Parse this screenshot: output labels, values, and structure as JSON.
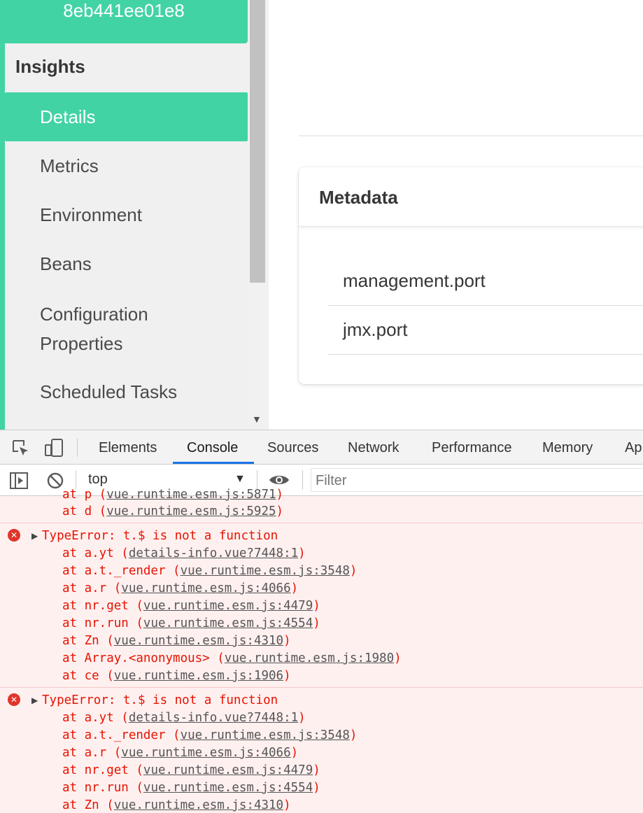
{
  "sidebar": {
    "app_id": "8eb441ee01e8",
    "section_label": "Insights",
    "items": [
      {
        "label": "Details",
        "active": true
      },
      {
        "label": "Metrics"
      },
      {
        "label": "Environment"
      },
      {
        "label": "Beans"
      },
      {
        "label": "Configuration Properties"
      },
      {
        "label": "Scheduled Tasks"
      }
    ]
  },
  "metadata": {
    "title": "Metadata",
    "keys": [
      "management.port",
      "jmx.port"
    ]
  },
  "devtools": {
    "tabs": [
      "Elements",
      "Console",
      "Sources",
      "Network",
      "Performance",
      "Memory",
      "Ap"
    ],
    "active_tab": "Console",
    "context": "top",
    "filter_placeholder": "Filter",
    "icons": [
      "inspect-element-icon",
      "device-toolbar-icon",
      "sidebar-toggle-icon",
      "clear-console-icon",
      "live-expression-eye-icon",
      "error-icon",
      "expand-triangle-icon"
    ]
  },
  "console": {
    "partial_lines": [
      {
        "prefix": "at p (",
        "link": "vue.runtime.esm.js:5871",
        "suffix": ")"
      },
      {
        "prefix": "at d (",
        "link": "vue.runtime.esm.js:5925",
        "suffix": ")"
      }
    ],
    "errors": [
      {
        "message": "TypeError: t.$ is not a function",
        "stack": [
          {
            "prefix": "at a.yt (",
            "link": "details-info.vue?7448:1",
            "suffix": ")"
          },
          {
            "prefix": "at a.t._render (",
            "link": "vue.runtime.esm.js:3548",
            "suffix": ")"
          },
          {
            "prefix": "at a.r (",
            "link": "vue.runtime.esm.js:4066",
            "suffix": ")"
          },
          {
            "prefix": "at nr.get (",
            "link": "vue.runtime.esm.js:4479",
            "suffix": ")"
          },
          {
            "prefix": "at nr.run (",
            "link": "vue.runtime.esm.js:4554",
            "suffix": ")"
          },
          {
            "prefix": "at Zn (",
            "link": "vue.runtime.esm.js:4310",
            "suffix": ")"
          },
          {
            "prefix": "at Array.<anonymous> (",
            "link": "vue.runtime.esm.js:1980",
            "suffix": ")"
          },
          {
            "prefix": "at ce (",
            "link": "vue.runtime.esm.js:1906",
            "suffix": ")"
          }
        ]
      },
      {
        "message": "TypeError: t.$ is not a function",
        "stack": [
          {
            "prefix": "at a.yt (",
            "link": "details-info.vue?7448:1",
            "suffix": ")"
          },
          {
            "prefix": "at a.t._render (",
            "link": "vue.runtime.esm.js:3548",
            "suffix": ")"
          },
          {
            "prefix": "at a.r (",
            "link": "vue.runtime.esm.js:4066",
            "suffix": ")"
          },
          {
            "prefix": "at nr.get (",
            "link": "vue.runtime.esm.js:4479",
            "suffix": ")"
          },
          {
            "prefix": "at nr.run (",
            "link": "vue.runtime.esm.js:4554",
            "suffix": ")"
          },
          {
            "prefix": "at Zn (",
            "link": "vue.runtime.esm.js:4310",
            "suffix": ")"
          }
        ]
      }
    ]
  },
  "colors": {
    "accent": "#42d3a5",
    "error_text": "#e51400",
    "error_background": "#fff0f0",
    "devtools_tab_underline": "#1a73e8"
  }
}
